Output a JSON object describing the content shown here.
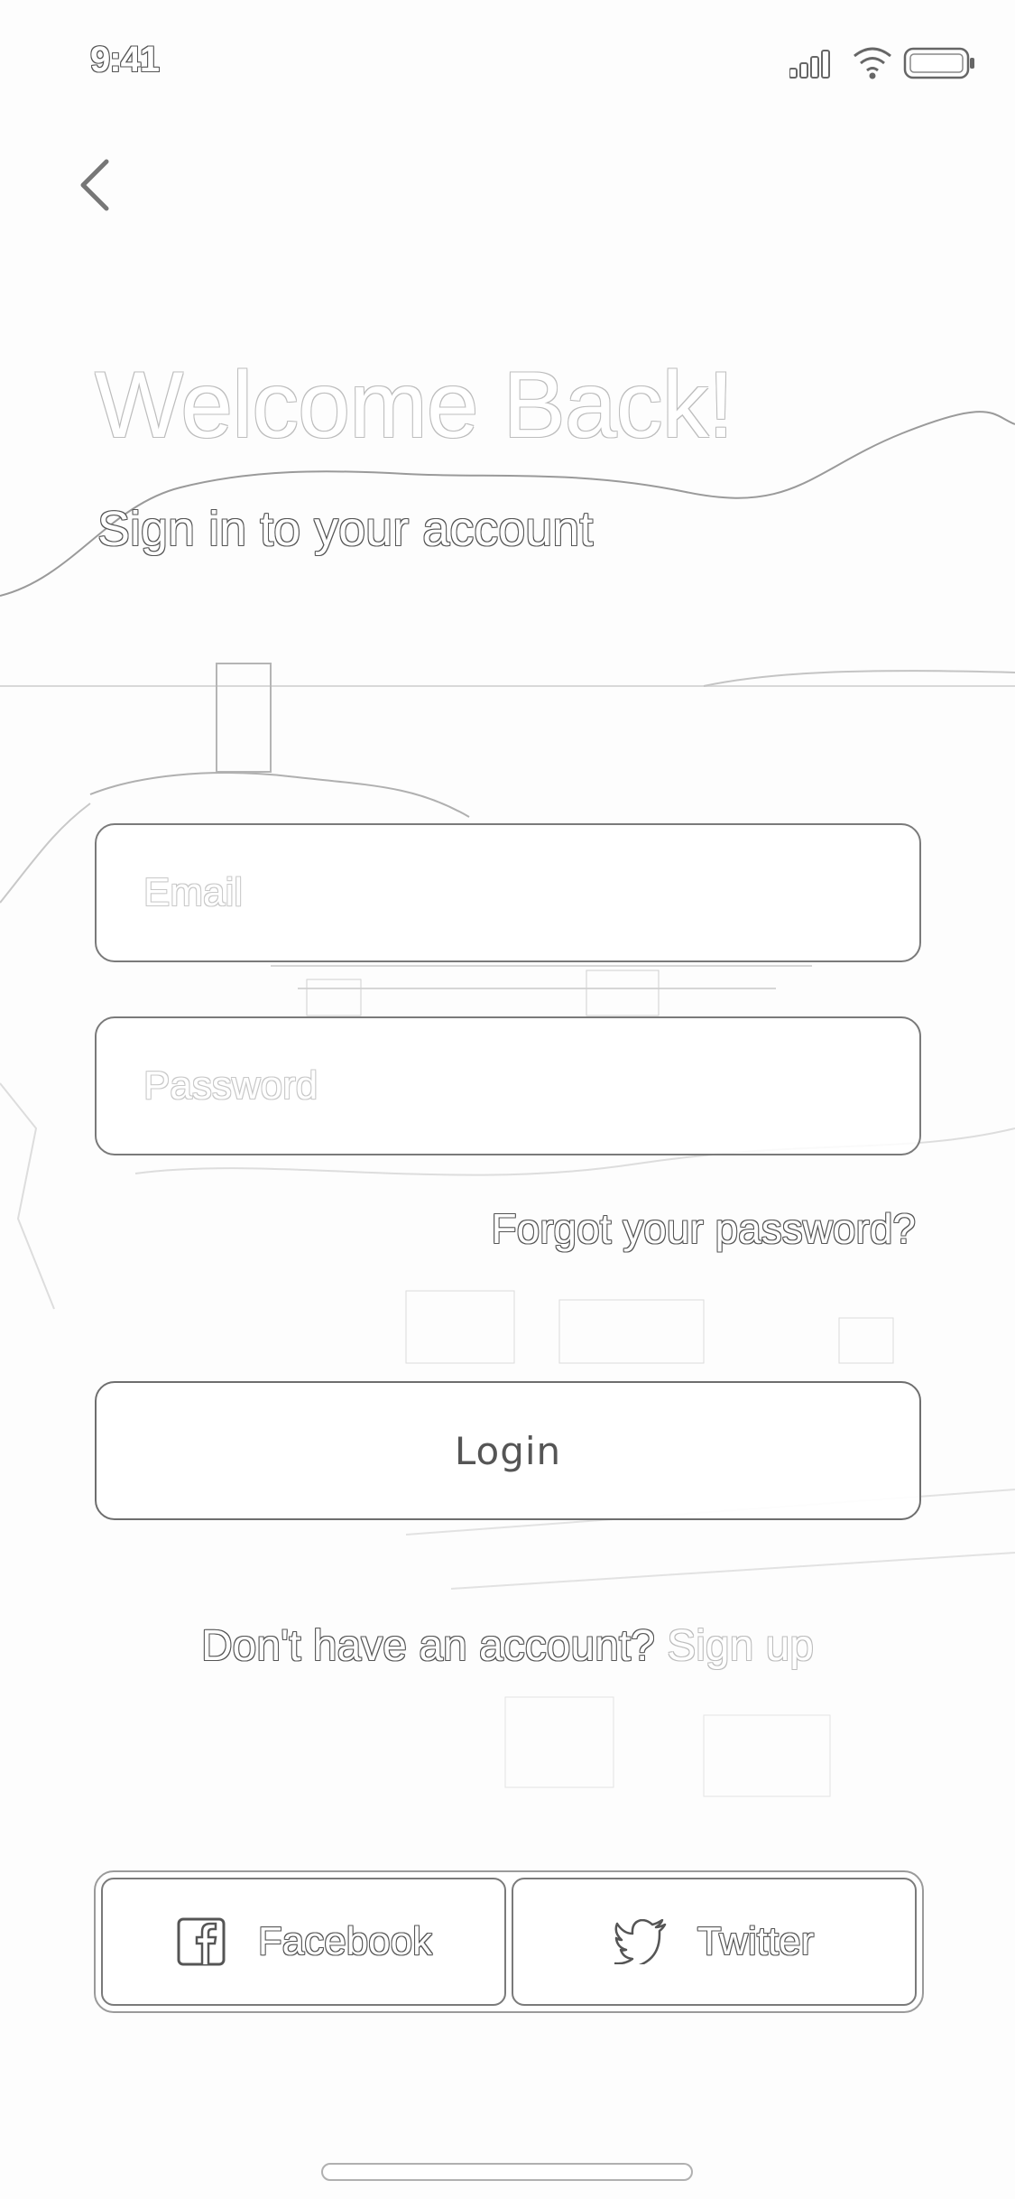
{
  "status_bar": {
    "time": "9:41",
    "icons": [
      "signal-icon",
      "wifi-icon",
      "battery-icon"
    ]
  },
  "navigation": {
    "back_icon": "chevron-left-icon"
  },
  "header": {
    "title": "Welcome Back!",
    "subtitle": "Sign in to your account"
  },
  "form": {
    "email": {
      "placeholder": "Email",
      "value": ""
    },
    "password": {
      "placeholder": "Password",
      "value": ""
    },
    "forgot_label": "Forgot your password?",
    "login_label": "Login"
  },
  "signup": {
    "prompt": "Don't have an account?",
    "link_label": "Sign up"
  },
  "social": {
    "facebook_label": "Facebook",
    "facebook_icon": "facebook-icon",
    "twitter_label": "Twitter",
    "twitter_icon": "twitter-icon"
  },
  "colors": {
    "outline": "#555555",
    "placeholder_outline": "#c8c8c8",
    "border": "#7a7a7a",
    "background": "#fdfdfd"
  }
}
